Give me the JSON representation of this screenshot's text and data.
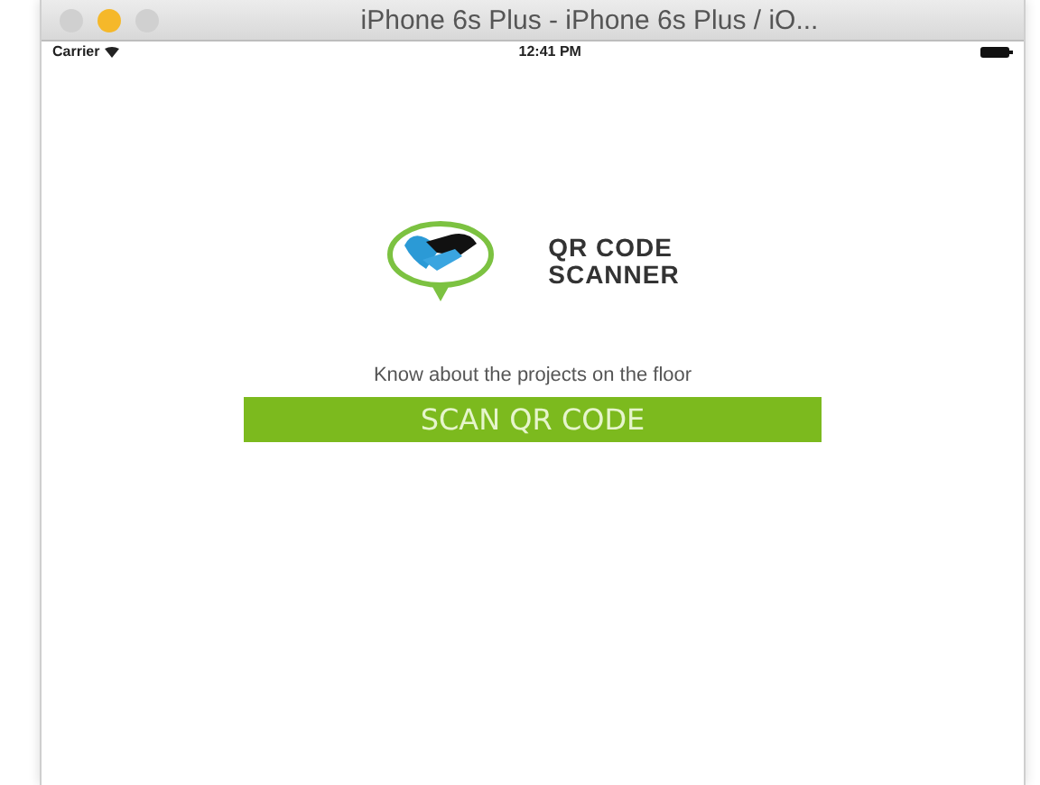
{
  "window": {
    "title": "iPhone 6s Plus - iPhone 6s Plus / iO..."
  },
  "status_bar": {
    "carrier": "Carrier",
    "time": "12:41 PM"
  },
  "logo": {
    "title_lines": [
      "QR CODE",
      "SCANNER"
    ]
  },
  "tagline": "Know about the projects on the floor",
  "scan_button": {
    "label": "SCAN QR CODE"
  }
}
